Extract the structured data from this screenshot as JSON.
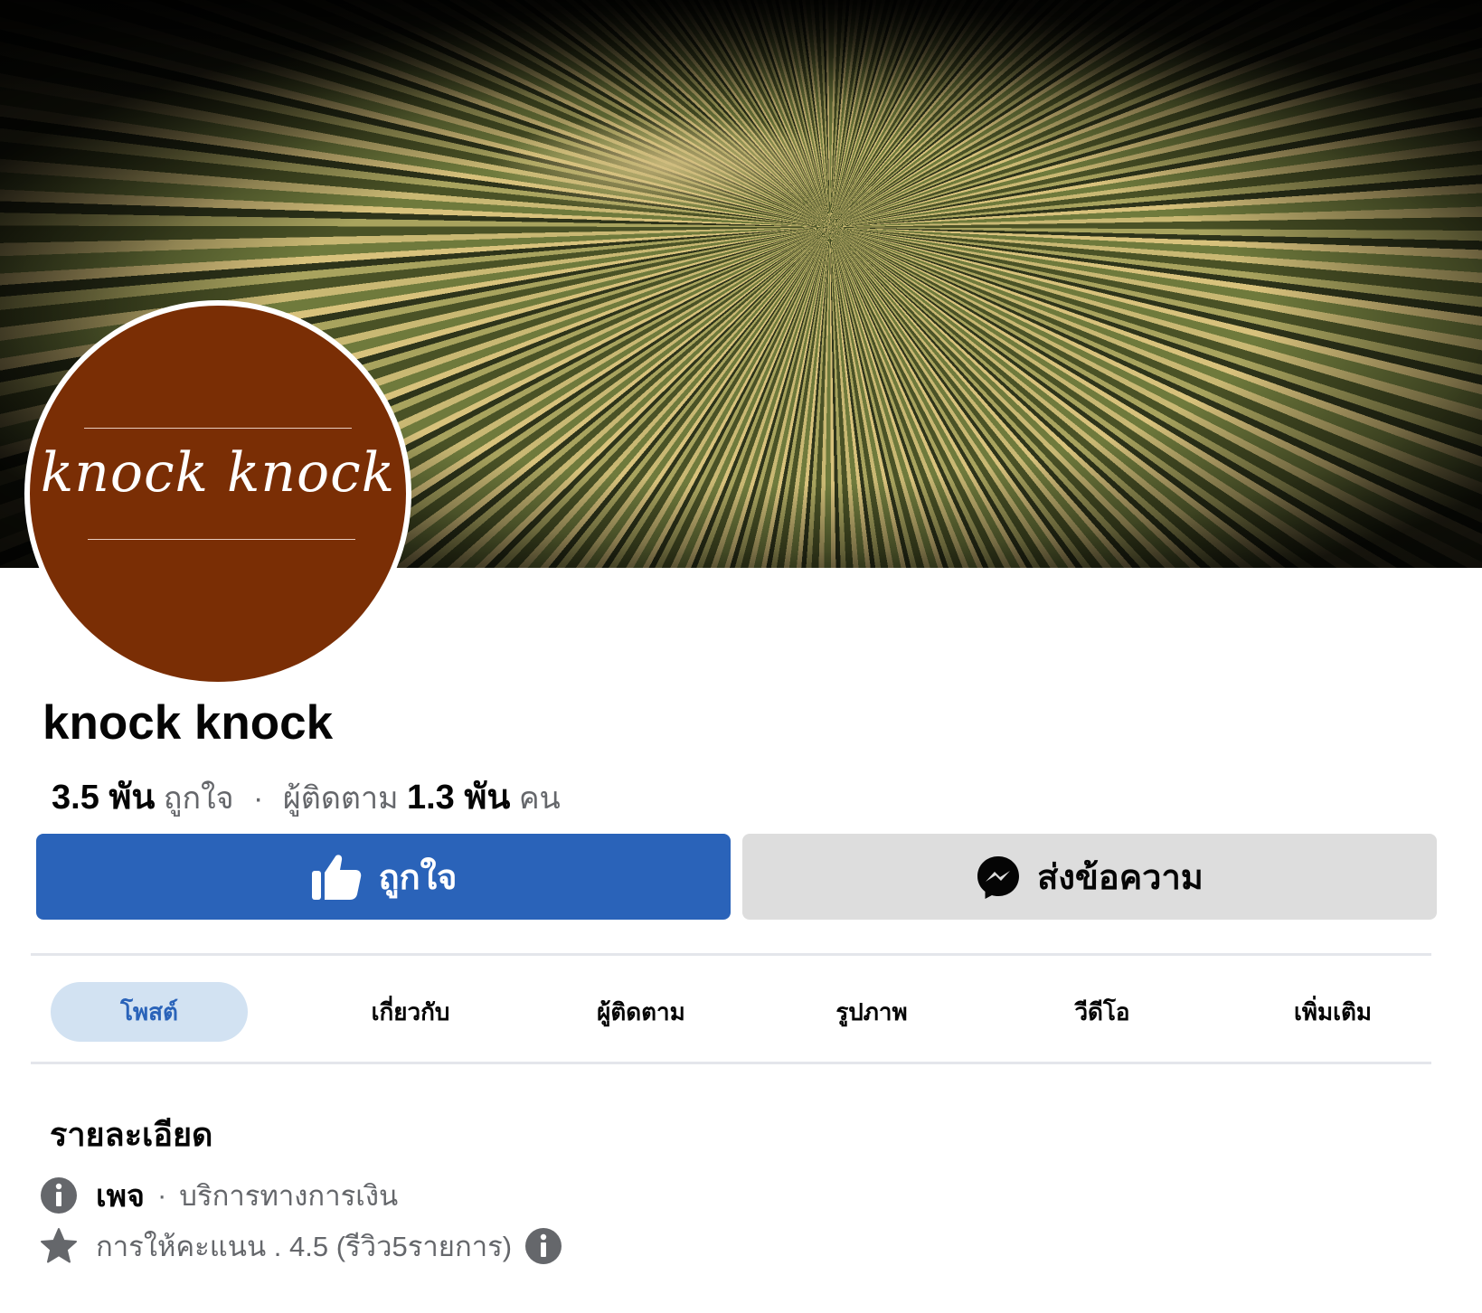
{
  "cover": {
    "description_icon": "money-cover-image"
  },
  "avatar": {
    "logo_text": "knock knock",
    "bg_color": "#7a2e05"
  },
  "page": {
    "name": "knock knock",
    "likes_count": "3.5 พัน",
    "likes_label": "ถูกใจ",
    "separator": "·",
    "followers_label": "ผู้ติดตาม",
    "followers_count": "1.3 พัน",
    "followers_unit": "คน"
  },
  "actions": {
    "like_label": "ถูกใจ",
    "message_label": "ส่งข้อความ",
    "like_color": "#2a63b9"
  },
  "tabs": [
    {
      "label": "โพสต์",
      "active": true
    },
    {
      "label": "เกี่ยวกับ",
      "active": false
    },
    {
      "label": "ผู้ติดตาม",
      "active": false
    },
    {
      "label": "รูปภาพ",
      "active": false
    },
    {
      "label": "วีดีโอ",
      "active": false
    },
    {
      "label": "เพิ่มเติม",
      "active": false
    }
  ],
  "details": {
    "title": "รายละเอียด",
    "category_type": "เพจ",
    "separator": "·",
    "category": "บริการทางการเงิน",
    "rating_text": "การให้คะแนน . 4.5 (รีวิว5รายการ)"
  },
  "icons": {
    "like": "thumbs-up-icon",
    "message": "messenger-icon",
    "info": "info-icon",
    "star": "star-icon"
  }
}
